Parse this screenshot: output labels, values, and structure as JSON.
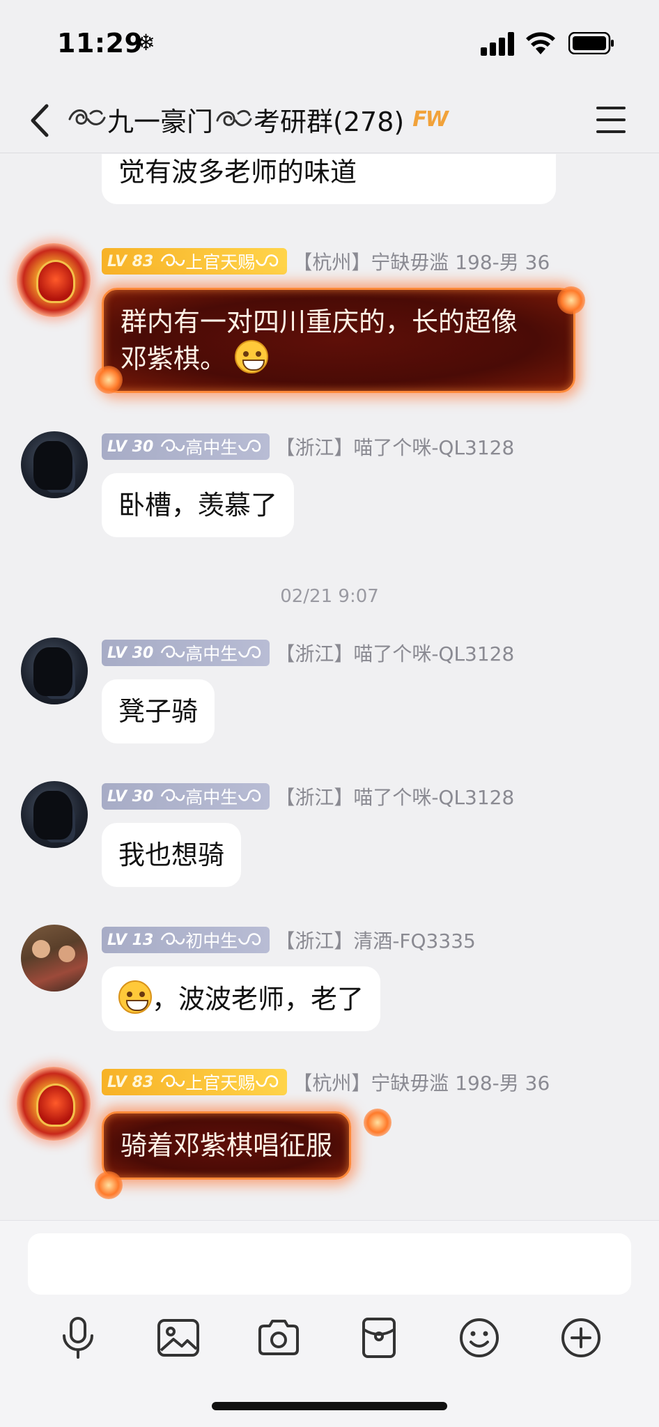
{
  "status_bar": {
    "time": "11:29",
    "extra_icon": "❄"
  },
  "header": {
    "title_left_flourish": "࿿",
    "title_part1": "九一豪门",
    "title_part2": "考研群(278)",
    "title_badge": "FW"
  },
  "top_partial_message": {
    "text": "觉有波多老师的味道"
  },
  "messages": [
    {
      "level": "LV 83",
      "title": "上官天赐",
      "sender": "【杭州】宁缺毋滥 198-男 36",
      "text": "群内有一对四川重庆的，长的超像",
      "text2": "邓紫棋。"
    },
    {
      "level": "LV 30",
      "title": "高中生",
      "sender": "【浙江】喵了个咪-QL3128",
      "text": "卧槽，羡慕了"
    },
    {
      "level": "LV 30",
      "title": "高中生",
      "sender": "【浙江】喵了个咪-QL3128",
      "text": "凳子骑"
    },
    {
      "level": "LV 30",
      "title": "高中生",
      "sender": "【浙江】喵了个咪-QL3128",
      "text": "我也想骑"
    },
    {
      "level": "LV 13",
      "title": "初中生",
      "sender": "【浙江】清酒-FQ3335",
      "text": "，波波老师，老了"
    },
    {
      "level": "LV 83",
      "title": "上官天赐",
      "sender": "【杭州】宁缺毋滥 198-男 36",
      "text": "骑着邓紫棋唱征服"
    }
  ],
  "timestamp": "02/21 9:07",
  "input": {
    "placeholder": ""
  },
  "toolbar_icons": [
    "microphone-icon",
    "image-icon",
    "camera-icon",
    "red-packet-icon",
    "emoji-icon",
    "plus-icon"
  ],
  "colors": {
    "background": "#f0f0f2",
    "gold_badge": "#f7b227",
    "gray_badge": "#a7acc6",
    "fire_bubble": "#5e0f08"
  }
}
